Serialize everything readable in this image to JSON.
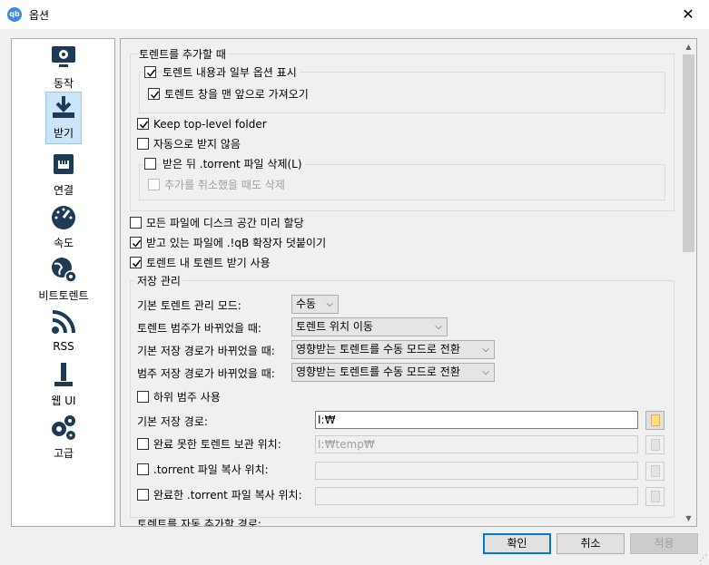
{
  "window": {
    "app_icon_text": "qb",
    "title": "옵션",
    "close_glyph": "✕"
  },
  "sidebar": {
    "items": [
      {
        "label": "동작",
        "icon": "monitor-gear-icon"
      },
      {
        "label": "받기",
        "icon": "download-icon",
        "selected": true
      },
      {
        "label": "연결",
        "icon": "network-port-icon"
      },
      {
        "label": "속도",
        "icon": "speedometer-icon"
      },
      {
        "label": "비트토렌트",
        "icon": "globe-gear-icon"
      },
      {
        "label": "RSS",
        "icon": "rss-icon"
      },
      {
        "label": "웹 UI",
        "icon": "web-ui-icon"
      },
      {
        "label": "고급",
        "icon": "gears-icon"
      }
    ]
  },
  "torrent_add": {
    "title": "토렌트를 추가할 때",
    "show_dialog": {
      "label": "토렌트 내용과 일부 옵션 표시",
      "checked": true
    },
    "bring_front": {
      "label": "토렌트 창을 맨 앞으로 가져오기",
      "checked": true
    },
    "keep_top_folder": {
      "label": "Keep top-level folder",
      "checked": true
    },
    "no_auto_start": {
      "label": "자동으로 받지 않음",
      "checked": false
    },
    "delete_torrent": {
      "label": "받은 뒤 .torrent 파일 삭제(L)",
      "checked": false
    },
    "delete_on_cancel": {
      "label": "추가를 취소했을 때도 삭제",
      "checked": false,
      "disabled": true
    }
  },
  "preallocate": {
    "label": "모든 파일에 디스크 공간 미리 할당",
    "checked": false
  },
  "append_ext": {
    "label": "받고 있는 파일에 .!qB 확장자 덧붙이기",
    "checked": true
  },
  "recursive": {
    "label": "토렌트 내 토렌트 받기 사용",
    "checked": true
  },
  "storage": {
    "title": "저장 관리",
    "mode_label": "기본 토렌트 관리 모드:",
    "mode_value": "수동",
    "category_changed_label": "토렌트 범주가 바뀌었을 때:",
    "category_changed_value": "토렌트 위치 이동",
    "default_path_changed_label": "기본 저장 경로가 바뀌었을 때:",
    "default_path_changed_value": "영향받는 토렌트를 수동 모드로 전환",
    "category_path_changed_label": "범주 저장 경로가 바뀌었을 때:",
    "category_path_changed_value": "영향받는 토렌트를 수동 모드로 전환",
    "subcategories": {
      "label": "하위 범주 사용",
      "checked": false
    },
    "save_path_label": "기본 저장 경로:",
    "save_path_value": "I:₩",
    "incomplete_label": "완료 못한 토렌트 보관 위치:",
    "incomplete_value": "I:₩temp₩",
    "copy_torrent_label": ".torrent 파일 복사 위치:",
    "copy_finished_label": "완료한 .torrent 파일 복사 위치:"
  },
  "auto_add_title": "토렌트를 자동 추가할 경로:",
  "buttons": {
    "ok": "확인",
    "cancel": "취소",
    "apply": "적용"
  }
}
